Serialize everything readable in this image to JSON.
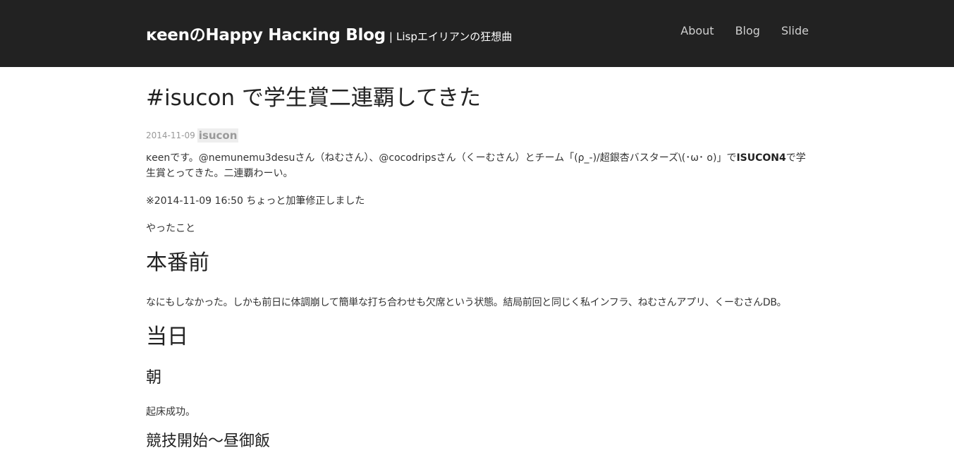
{
  "header": {
    "title": "ĸeenのHappy Hacĸing Blog",
    "separator": "|",
    "subtitle": "Lispエイリアンの狂想曲",
    "nav": [
      {
        "label": "About"
      },
      {
        "label": "Blog"
      },
      {
        "label": "Slide"
      }
    ]
  },
  "post": {
    "title": "#isucon で学生賞二連覇してきた",
    "date": "2014-11-09",
    "tag": "isucon",
    "intro_before": "ĸeenです。@nemunemu3desuさん（ねむさん）、@cocodripsさん（くーむさん）とチーム「(ρ_-)/超銀杏バスターズ\\(･ω･ o)」で",
    "intro_bold": "ISUCON4",
    "intro_after": "で学生賞とってきた。二連覇わーい。",
    "note": "※2014-11-09 16:50 ちょっと加筆修正しました",
    "did": "やったこと",
    "section_before": "本番前",
    "section_before_text": "なにもしなかった。しかも前日に体調崩して簡単な打ち合わせも欠席という状態。結局前回と同じく私インフラ、ねむさんアプリ、くーむさんDB。",
    "section_day": "当日",
    "sub_morning": "朝",
    "sub_morning_text": "起床成功。",
    "sub_competition": "競技開始〜昼御飯"
  }
}
